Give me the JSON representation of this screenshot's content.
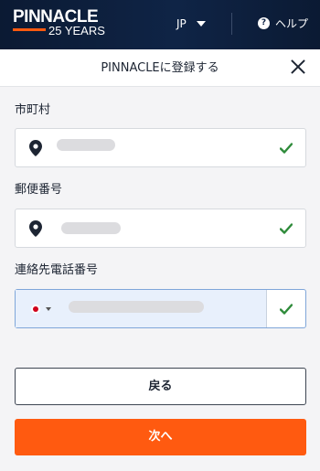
{
  "header": {
    "logo_text": "PINNACLE",
    "logo_subtext": "25 YEARS",
    "language": "JP",
    "help_label": "ヘルプ"
  },
  "modal": {
    "title": "PINNACLEに登録する"
  },
  "form": {
    "city": {
      "label": "市町村",
      "icon": "location-pin-icon",
      "status_icon": "checkmark-icon"
    },
    "postal_code": {
      "label": "郵便番号",
      "icon": "location-pin-icon",
      "status_icon": "checkmark-icon"
    },
    "phone": {
      "label": "連絡先電話番号",
      "country_flag": "japan-flag-icon",
      "status_icon": "checkmark-icon"
    }
  },
  "buttons": {
    "back_label": "戻る",
    "next_label": "次へ"
  },
  "colors": {
    "header_bg": "#0f2446",
    "accent": "#ff5a10",
    "success": "#2e8b3a",
    "phone_field_bg": "#e8f0fc"
  }
}
